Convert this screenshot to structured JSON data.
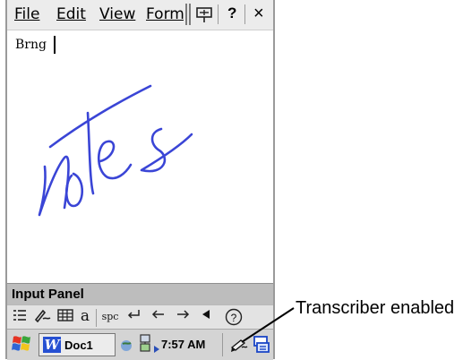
{
  "menu": {
    "file": "File",
    "edit": "Edit",
    "view": "View",
    "format": "Form"
  },
  "toolbar_top": {
    "help_label": "?",
    "close_label": "×"
  },
  "document": {
    "text": "Brng"
  },
  "handwriting": {
    "color": "#3a45d6",
    "recognized": "notes"
  },
  "input_panel": {
    "title": "Input Panel",
    "spc_label": "spc",
    "help_label": "?"
  },
  "taskbar": {
    "doc_label": "Doc1",
    "app_initial": "W",
    "clock": "7:57 AM"
  },
  "callout": {
    "text": "Transcriber enabled"
  }
}
